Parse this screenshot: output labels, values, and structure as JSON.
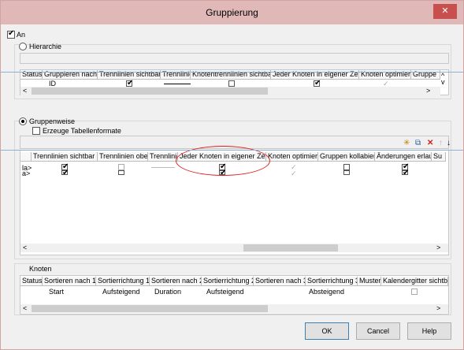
{
  "window": {
    "title": "Gruppierung",
    "close_glyph": "✕"
  },
  "top_checkbox": {
    "label": "An",
    "checked": true
  },
  "hierarchy": {
    "label": "Hierarchie",
    "columns": [
      "Status",
      "Gruppieren nach",
      "Trennlinien sichtbar",
      "Trennlinie",
      "Knotentrennlinien sichtbar",
      "Jeder Knoten in eigener Zeile",
      "Knoten optimiert",
      "Gruppe"
    ],
    "row": {
      "gruppieren_nach": "ID"
    }
  },
  "groupwise": {
    "label": "Gruppenweise",
    "create_table_formats": "Erzeuge Tabellenformate",
    "columns": [
      "Trennlinien sichtbar",
      "Trennlinien oben",
      "Trennlinie",
      "Jeder Knoten in eigener Zeile",
      "Knoten optimiert",
      "Gruppen kollabiert",
      "Änderungen erlaubt",
      "Su"
    ],
    "rows": [
      {
        "lead": "la>"
      },
      {
        "lead": "a>"
      }
    ]
  },
  "nodes": {
    "label": "Knoten",
    "columns": [
      "Status",
      "Sortieren nach 1",
      "Sortierrichtung 1",
      "Sortieren nach 2",
      "Sortierrichtung 2",
      "Sortieren nach 3",
      "Sortierrichtung 3",
      "Muster",
      "Kalendergitter sichtbar"
    ],
    "row": [
      "",
      "Start",
      "Aufsteigend",
      "Duration",
      "Aufsteigend",
      "",
      "Absteigend",
      "",
      ""
    ]
  },
  "buttons": {
    "ok": "OK",
    "cancel": "Cancel",
    "help": "Help"
  },
  "icons": {
    "new_row": "✳",
    "copy": "⧉",
    "delete": "✕",
    "up": "↑",
    "down": "↓",
    "scroll_left": "<",
    "scroll_right": ">",
    "scroll_up": "^",
    "scroll_down": "v"
  }
}
